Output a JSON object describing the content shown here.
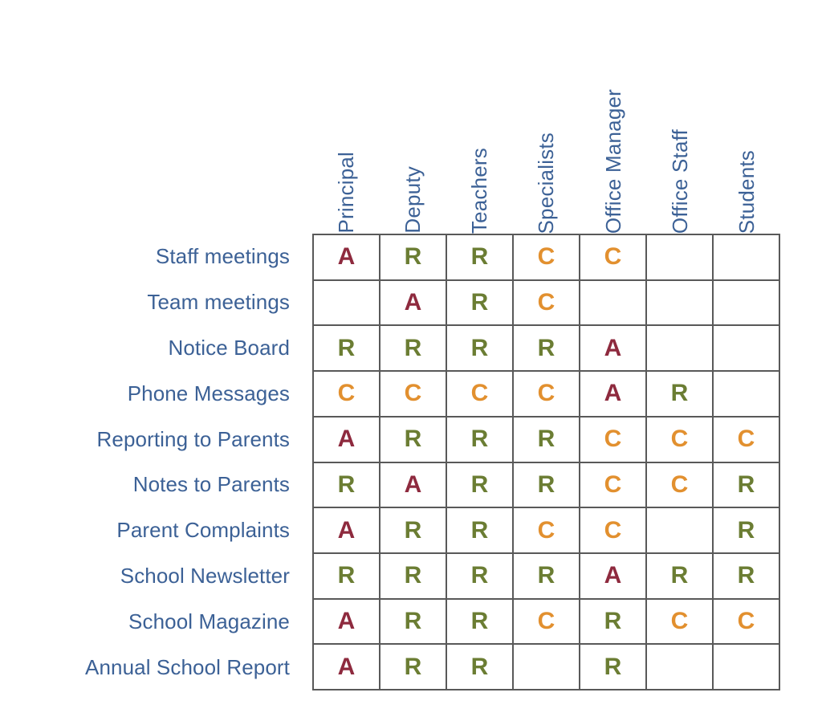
{
  "chart_data": {
    "type": "table",
    "title": "",
    "columns": [
      "Principal",
      "Deputy",
      "Teachers",
      "Specialists",
      "Office Manager",
      "Office Staff",
      "Students"
    ],
    "rows": [
      "Staff meetings",
      "Team meetings",
      "Notice Board",
      "Phone Messages",
      "Reporting to Parents",
      "Notes to Parents",
      "Parent Complaints",
      "School Newsletter",
      "School Magazine",
      "Annual School Report"
    ],
    "values": [
      [
        "A",
        "R",
        "R",
        "C",
        "C",
        "",
        ""
      ],
      [
        "",
        "A",
        "R",
        "C",
        "",
        "",
        ""
      ],
      [
        "R",
        "R",
        "R",
        "R",
        "A",
        "",
        ""
      ],
      [
        "C",
        "C",
        "C",
        "C",
        "A",
        "R",
        ""
      ],
      [
        "A",
        "R",
        "R",
        "R",
        "C",
        "C",
        "C"
      ],
      [
        "R",
        "A",
        "R",
        "R",
        "C",
        "C",
        "R"
      ],
      [
        "A",
        "R",
        "R",
        "C",
        "C",
        "",
        "R"
      ],
      [
        "R",
        "R",
        "R",
        "R",
        "A",
        "R",
        "R"
      ],
      [
        "A",
        "R",
        "R",
        "C",
        "R",
        "C",
        "C"
      ],
      [
        "A",
        "R",
        "R",
        "",
        "R",
        "",
        ""
      ]
    ],
    "codes": {
      "A": "A",
      "R": "R",
      "C": "C"
    },
    "colors": {
      "A": "#8E2A3E",
      "R": "#6B7D33",
      "C": "#E2902F",
      "label_text": "#3C6196",
      "grid_line": "#595959",
      "background": "#FFFFFF"
    },
    "grid": true,
    "xlabel": "",
    "ylabel": ""
  }
}
